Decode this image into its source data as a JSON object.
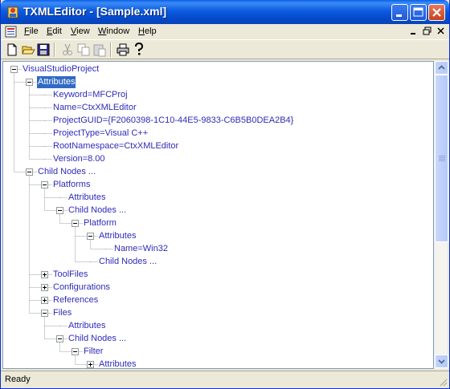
{
  "window": {
    "title": "TXMLEditor - [Sample.xml]"
  },
  "menu": {
    "items": [
      {
        "label": "File",
        "hotkey": "F",
        "rest": "ile"
      },
      {
        "label": "Edit",
        "hotkey": "E",
        "rest": "dit"
      },
      {
        "label": "View",
        "hotkey": "V",
        "rest": "iew"
      },
      {
        "label": "Window",
        "hotkey": "W",
        "rest": "indow"
      },
      {
        "label": "Help",
        "hotkey": "H",
        "rest": "elp"
      }
    ]
  },
  "toolbar": {
    "buttons": [
      {
        "name": "new-icon",
        "enabled": true
      },
      {
        "name": "open-icon",
        "enabled": true
      },
      {
        "name": "save-icon",
        "enabled": true
      },
      {
        "name": "cut-icon",
        "enabled": false
      },
      {
        "name": "copy-icon",
        "enabled": false
      },
      {
        "name": "paste-icon",
        "enabled": false
      },
      {
        "name": "print-icon",
        "enabled": true
      },
      {
        "name": "help-icon",
        "enabled": true
      }
    ]
  },
  "tree": {
    "nodes": [
      {
        "label": "VisualStudioProject",
        "depth": 0,
        "expander": "minus"
      },
      {
        "label": "Attributes",
        "depth": 1,
        "expander": "minus",
        "selected": true
      },
      {
        "label": "Keyword=MFCProj",
        "depth": 2,
        "expander": "none"
      },
      {
        "label": "Name=CtxXMLEditor",
        "depth": 2,
        "expander": "none"
      },
      {
        "label": "ProjectGUID={F2060398-1C10-44E5-9833-C6B5B0DEA2B4}",
        "depth": 2,
        "expander": "none"
      },
      {
        "label": "ProjectType=Visual C++",
        "depth": 2,
        "expander": "none"
      },
      {
        "label": "RootNamespace=CtxXMLEditor",
        "depth": 2,
        "expander": "none"
      },
      {
        "label": "Version=8.00",
        "depth": 2,
        "expander": "none"
      },
      {
        "label": "Child Nodes ...",
        "depth": 1,
        "expander": "minus"
      },
      {
        "label": "Platforms",
        "depth": 2,
        "expander": "minus"
      },
      {
        "label": "Attributes",
        "depth": 3,
        "expander": "none"
      },
      {
        "label": "Child Nodes ...",
        "depth": 3,
        "expander": "minus"
      },
      {
        "label": "Platform",
        "depth": 4,
        "expander": "minus"
      },
      {
        "label": "Attributes",
        "depth": 5,
        "expander": "minus"
      },
      {
        "label": "Name=Win32",
        "depth": 6,
        "expander": "none"
      },
      {
        "label": "Child Nodes ...",
        "depth": 5,
        "expander": "none"
      },
      {
        "label": "ToolFiles",
        "depth": 2,
        "expander": "plus"
      },
      {
        "label": "Configurations",
        "depth": 2,
        "expander": "plus"
      },
      {
        "label": "References",
        "depth": 2,
        "expander": "plus"
      },
      {
        "label": "Files",
        "depth": 2,
        "expander": "minus"
      },
      {
        "label": "Attributes",
        "depth": 3,
        "expander": "none"
      },
      {
        "label": "Child Nodes ...",
        "depth": 3,
        "expander": "minus"
      },
      {
        "label": "Filter",
        "depth": 4,
        "expander": "minus"
      },
      {
        "label": "Attributes",
        "depth": 5,
        "expander": "plus"
      }
    ]
  },
  "scrollbar": {
    "thumb_fraction": 0.6
  },
  "status": {
    "text": "Ready"
  },
  "colors": {
    "title_bar": "#0548c9",
    "node_text": "#2e2bb8",
    "selection": "#316ac5",
    "tree_lines": "#a0a0a0"
  }
}
